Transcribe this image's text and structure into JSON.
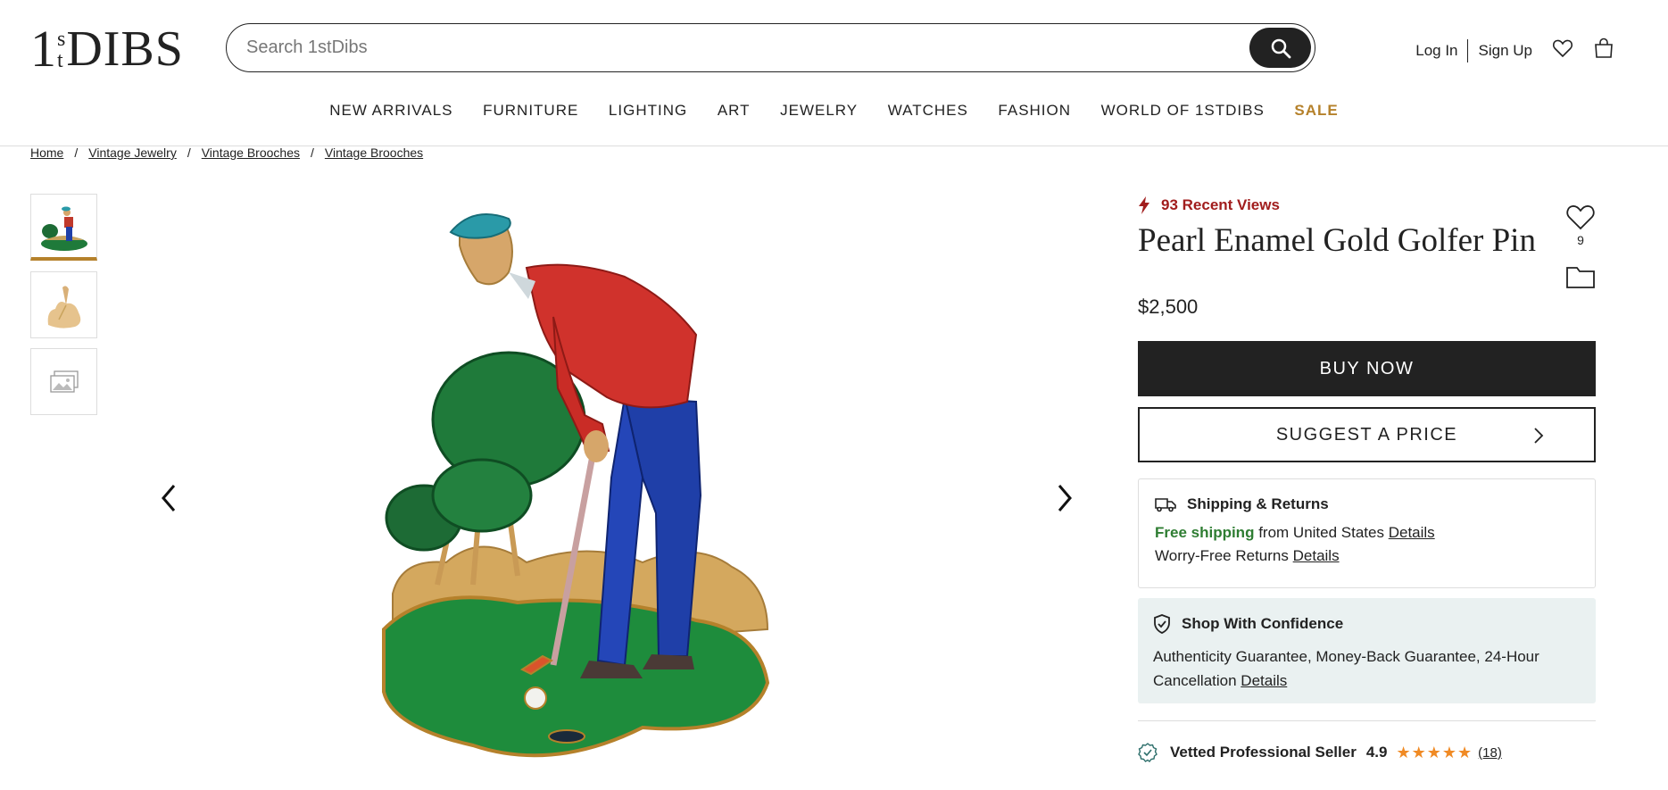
{
  "logo": {
    "one": "1",
    "st_top": "s",
    "st_bottom": "t",
    "dibs": "DIBS"
  },
  "search": {
    "placeholder": "Search 1stDibs"
  },
  "account": {
    "login": "Log In",
    "signup": "Sign Up"
  },
  "nav": [
    "NEW ARRIVALS",
    "FURNITURE",
    "LIGHTING",
    "ART",
    "JEWELRY",
    "WATCHES",
    "FASHION",
    "WORLD OF 1STDIBS",
    "SALE"
  ],
  "breadcrumb": [
    "Home",
    "Vintage Jewelry",
    "Vintage Brooches",
    "Vintage Brooches"
  ],
  "breadcrumb_sep": "/",
  "product": {
    "recent_views": "93 Recent Views",
    "title": "Pearl Enamel Gold Golfer Pin",
    "favorites_count": "9",
    "price": "$2,500",
    "buy_now": "BUY NOW",
    "suggest_price": "SUGGEST A PRICE"
  },
  "shipping": {
    "title": "Shipping & Returns",
    "free": "Free shipping",
    "from": "from United States",
    "details1": "Details",
    "returns": "Worry-Free Returns",
    "details2": "Details"
  },
  "confidence": {
    "title": "Shop With Confidence",
    "body": "Authenticity Guarantee, Money-Back Guarantee, 24-Hour Cancellation",
    "details": "Details"
  },
  "seller": {
    "label": "Vetted Professional Seller",
    "rating": "4.9",
    "stars": "★★★★★",
    "reviews": "(18)"
  },
  "colors": {
    "accent": "#b5812b",
    "alert": "#a11d1d",
    "green": "#2e7d32",
    "dark": "#222222",
    "star": "#f08a24"
  }
}
